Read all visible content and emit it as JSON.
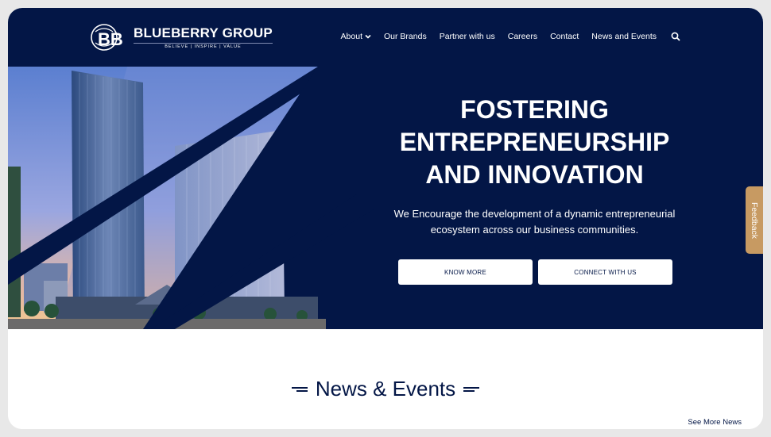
{
  "brand": {
    "logo_initials": "BB",
    "name": "BLUEBERRY GROUP",
    "tagline": "BELIEVE | INSPIRE | VALUE"
  },
  "nav": {
    "items": [
      {
        "label": "About",
        "has_dropdown": true
      },
      {
        "label": "Our Brands"
      },
      {
        "label": "Partner with us"
      },
      {
        "label": "Careers"
      },
      {
        "label": "Contact"
      },
      {
        "label": "News and Events"
      }
    ],
    "search_icon": "search-icon"
  },
  "hero": {
    "title_lines": [
      "FOSTERING",
      "ENTREPRENEURSHIP",
      "AND INNOVATION"
    ],
    "subtitle": "We Encourage the development of a dynamic entrepreneurial ecosystem across our business communities.",
    "buttons": {
      "know_more": "KNOW MORE",
      "connect": "CONNECT WITH US"
    }
  },
  "feedback_tab": "Feedback",
  "news": {
    "heading": "News & Events",
    "see_more": "See More News"
  },
  "colors": {
    "navy": "#031646",
    "feedback": "#c79a62",
    "white": "#ffffff"
  }
}
